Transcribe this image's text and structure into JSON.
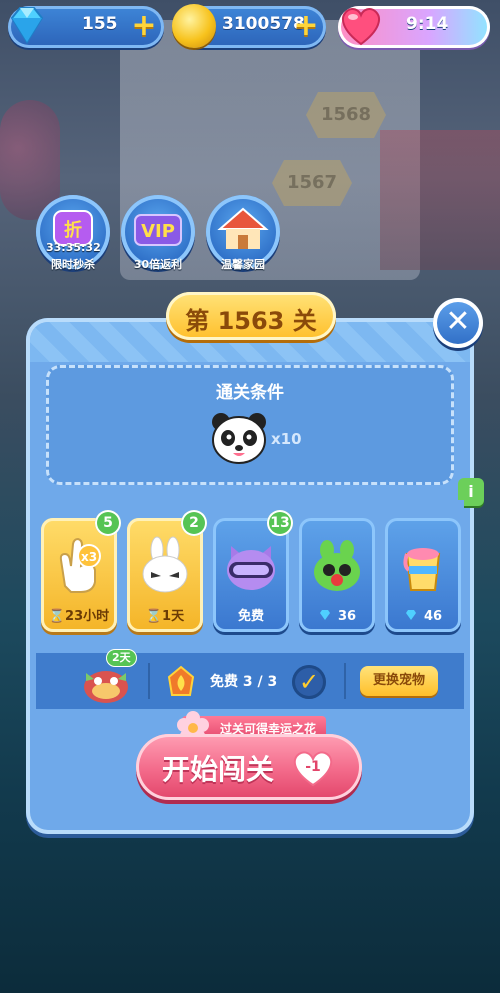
{
  "top_bar": {
    "diamonds": "155",
    "coins": "3100578",
    "lives_timer": "9:14"
  },
  "features": [
    {
      "label": "限时秒杀",
      "icon": "discount-icon",
      "icon_text": "折",
      "timer": "33:35:32"
    },
    {
      "label": "30倍返利",
      "icon": "vip-icon",
      "icon_text": "VIP"
    },
    {
      "label": "温馨家园",
      "icon": "house-icon"
    }
  ],
  "background": {
    "level_markers": [
      "1568",
      "1567"
    ]
  },
  "level": {
    "title": "第 1563 关"
  },
  "goal": {
    "title": "通关条件",
    "target_icon": "panda-icon",
    "count": "x10"
  },
  "boosters": [
    {
      "style": "gold",
      "icon": "hand-x3-icon",
      "badge": "5",
      "label": "⌛23小时"
    },
    {
      "style": "gold",
      "icon": "bunny-icon",
      "badge": "2",
      "label": "⌛1天"
    },
    {
      "style": "blue",
      "icon": "cat-goggles-icon",
      "badge": "13",
      "label": "免费"
    },
    {
      "style": "blue",
      "icon": "frog-icon",
      "badge": "",
      "label": "36",
      "currency": "diamond"
    },
    {
      "style": "blue",
      "icon": "paint-bucket-icon",
      "badge": "",
      "label": "46",
      "currency": "diamond"
    }
  ],
  "pet": {
    "days_badge": "2天",
    "free_label": "免费 3 / 3",
    "change_button": "更换宠物"
  },
  "start": {
    "reward_tip": "过关可得幸运之花",
    "label": "开始闯关",
    "cost": "-1"
  },
  "info_tab": "i",
  "colors": {
    "accent_gold": "#ffbf2a",
    "panel_blue": "#6fa9ea",
    "start_pink": "#f36a8a",
    "badge_green": "#56c454"
  }
}
